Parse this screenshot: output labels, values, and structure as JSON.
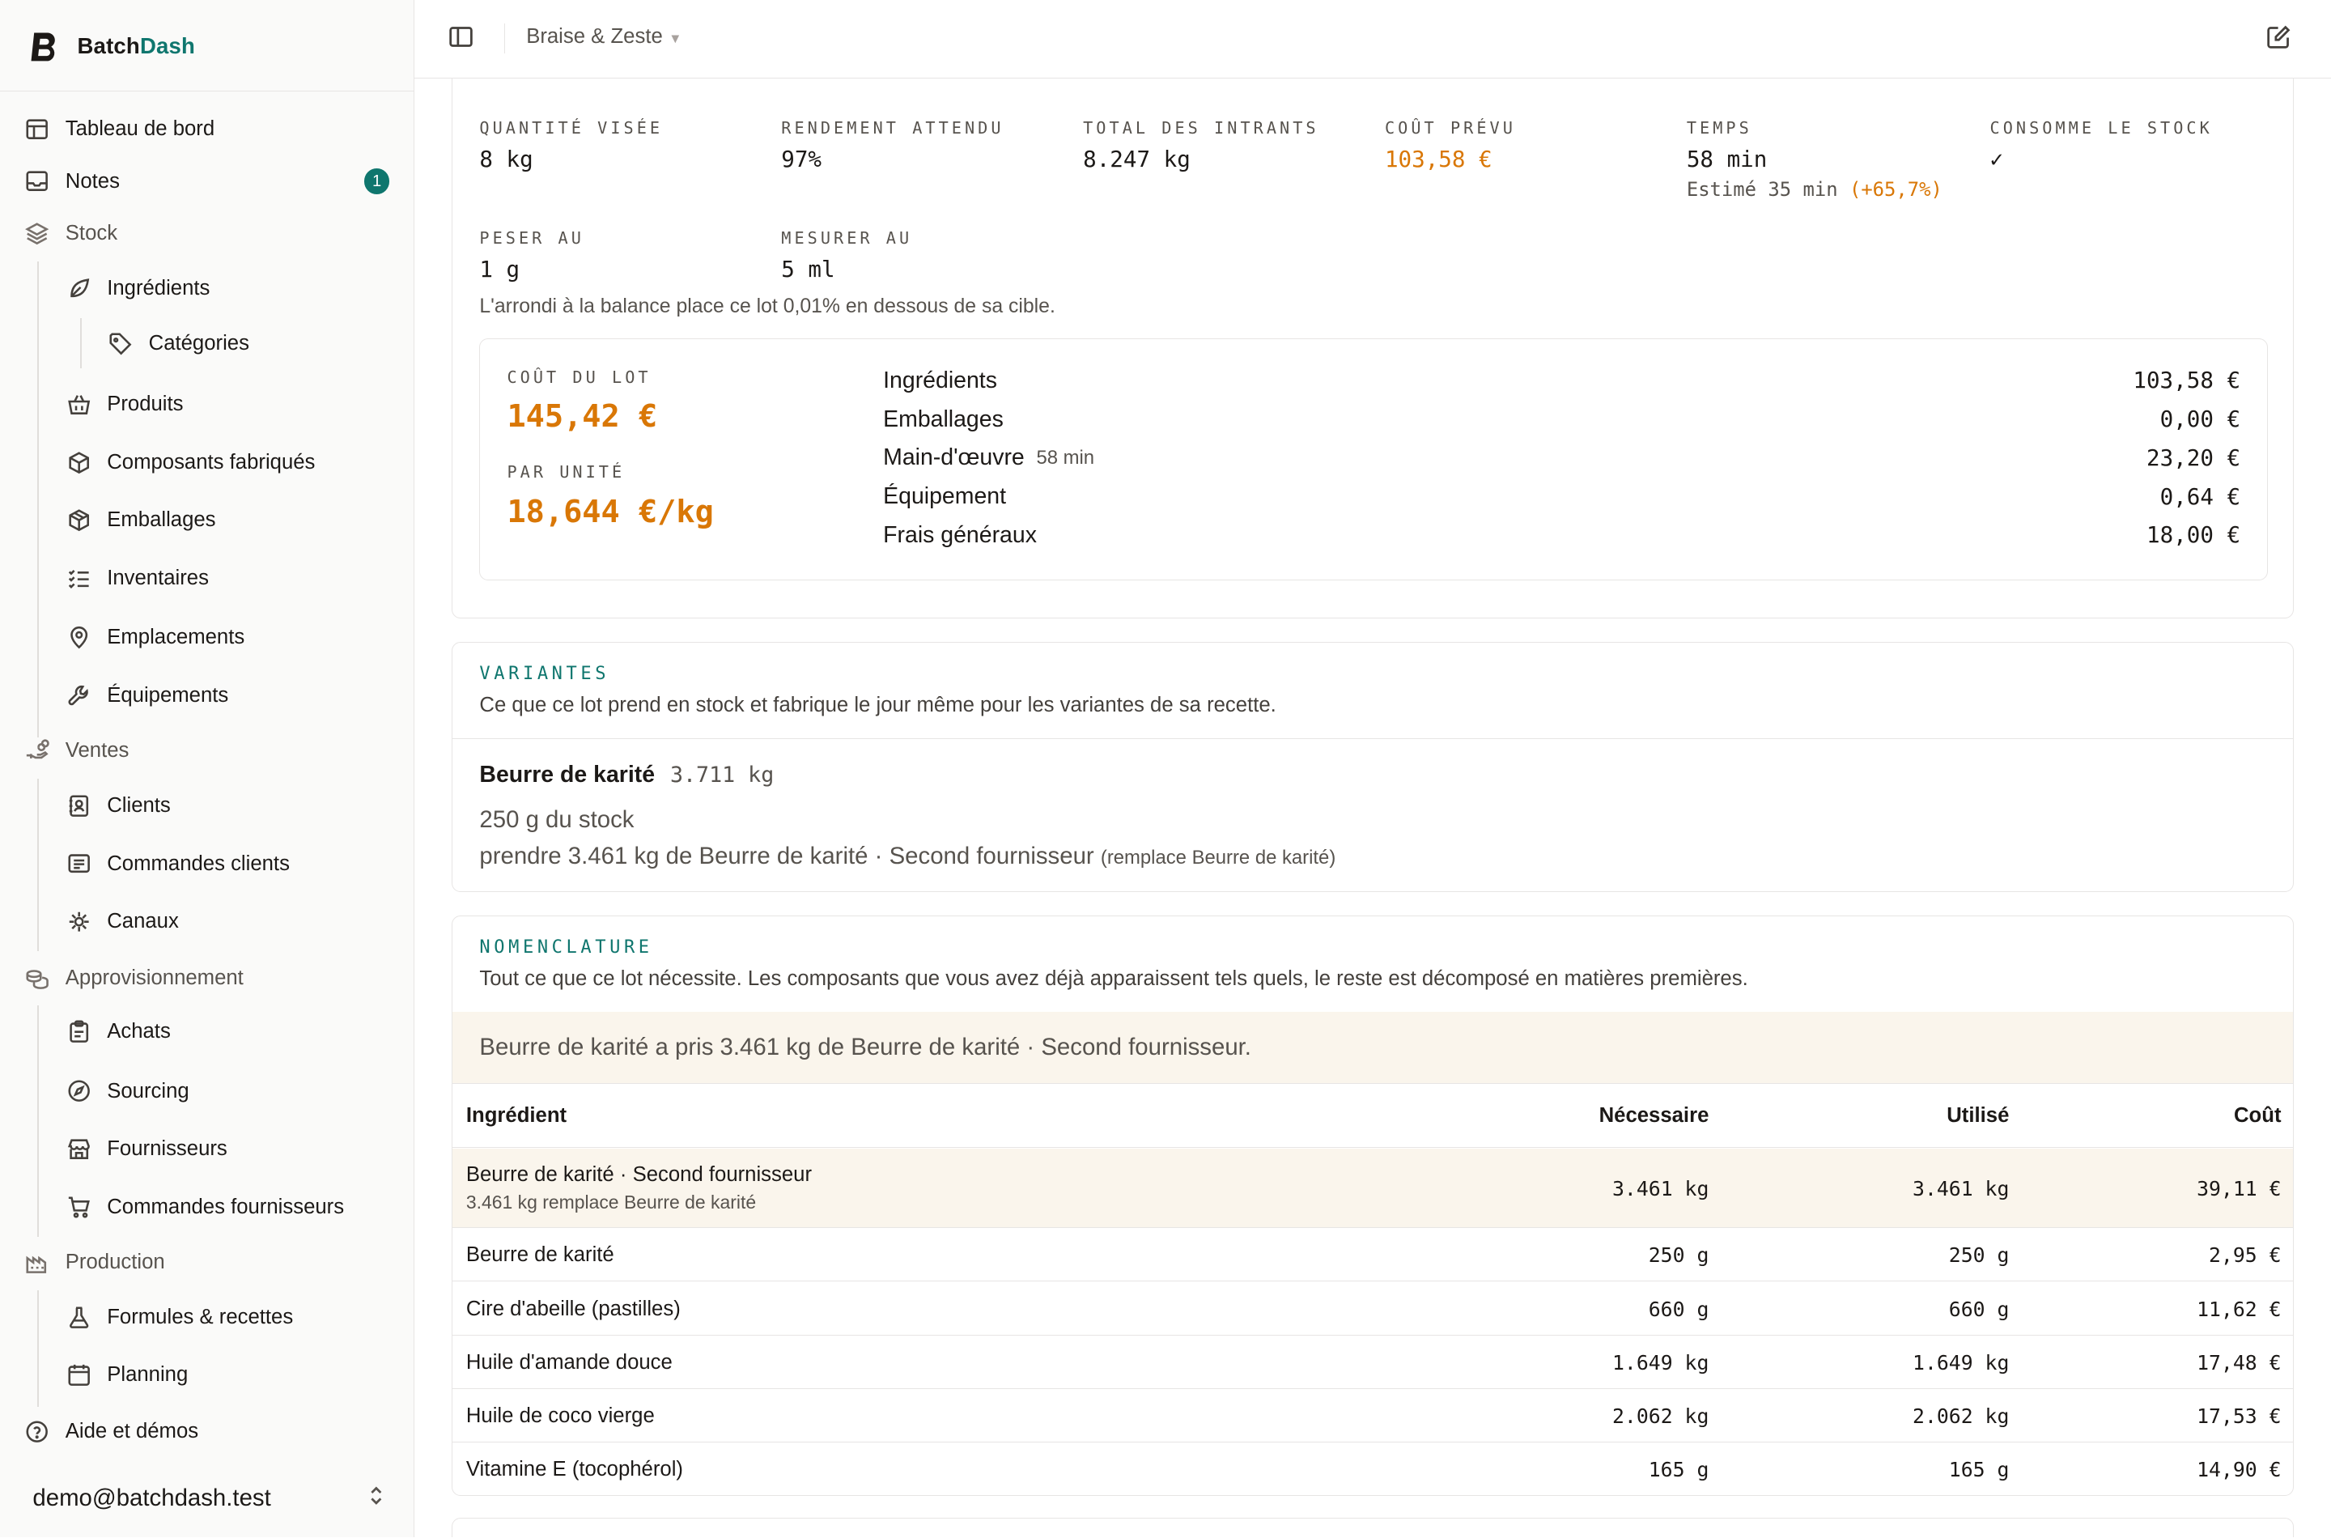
{
  "app": {
    "brand_prefix": "Batch",
    "brand_suffix": "Dash",
    "brand_color": "#0f766e",
    "accent_orange": "#d97706"
  },
  "sidebar": {
    "items": [
      {
        "label": "Tableau de bord",
        "icon": "dashboard-icon"
      },
      {
        "label": "Notes",
        "icon": "inbox-icon",
        "badge": "1"
      },
      {
        "label": "Stock",
        "icon": "layers-icon",
        "group": true
      },
      {
        "label": "Ingrédients",
        "icon": "leaf-icon"
      },
      {
        "label": "Catégories",
        "icon": "tag-icon"
      },
      {
        "label": "Produits",
        "icon": "basket-icon"
      },
      {
        "label": "Composants fabriqués",
        "icon": "cube-icon"
      },
      {
        "label": "Emballages",
        "icon": "package-icon"
      },
      {
        "label": "Inventaires",
        "icon": "checklist-icon"
      },
      {
        "label": "Emplacements",
        "icon": "map-pin-icon"
      },
      {
        "label": "Équipements",
        "icon": "wrench-icon"
      },
      {
        "label": "Ventes",
        "icon": "hand-coins-icon",
        "group": true
      },
      {
        "label": "Clients",
        "icon": "contact-icon"
      },
      {
        "label": "Commandes clients",
        "icon": "receipt-icon"
      },
      {
        "label": "Canaux",
        "icon": "network-icon"
      },
      {
        "label": "Approvisionnement",
        "icon": "coins-icon",
        "group": true
      },
      {
        "label": "Achats",
        "icon": "clipboard-icon"
      },
      {
        "label": "Sourcing",
        "icon": "compass-icon"
      },
      {
        "label": "Fournisseurs",
        "icon": "store-icon"
      },
      {
        "label": "Commandes fournisseurs",
        "icon": "cart-icon"
      },
      {
        "label": "Production",
        "icon": "factory-icon",
        "group": true
      },
      {
        "label": "Formules & recettes",
        "icon": "flask-icon"
      },
      {
        "label": "Planning",
        "icon": "calendar-icon"
      },
      {
        "label": "Aide et démos",
        "icon": "help-icon"
      }
    ],
    "user_email": "demo@batchdash.test"
  },
  "topbar": {
    "workspace": "Braise & Zeste"
  },
  "summary": {
    "stats": [
      {
        "label": "QUANTITÉ VISÉE",
        "value": "8 kg"
      },
      {
        "label": "RENDEMENT ATTENDU",
        "value": "97%"
      },
      {
        "label": "TOTAL DES INTRANTS",
        "value": "8.247 kg"
      },
      {
        "label": "COÛT PRÉVU",
        "value": "103,58 €"
      },
      {
        "label": "TEMPS",
        "value": "58 min",
        "note_prefix": "Estimé 35 min",
        "note_delta": "(+65,7%)"
      },
      {
        "label": "CONSOMME LE STOCK",
        "value": "✓"
      },
      {
        "label": "PESER AU",
        "value": "1 g"
      },
      {
        "label": "MESURER AU",
        "value": "5 ml"
      }
    ],
    "rounding_note": "L'arrondi à la balance place ce lot 0,01% en dessous de sa cible.",
    "cost_box": {
      "batch_label": "COÛT DU LOT",
      "batch_value": "145,42 €",
      "unit_label": "PAR UNITÉ",
      "unit_value": "18,644 €/kg",
      "rows": [
        {
          "label": "Ingrédients",
          "amount": "103,58 €"
        },
        {
          "label": "Emballages",
          "amount": "0,00 €"
        },
        {
          "label": "Main-d'œuvre",
          "note": "58 min",
          "amount": "23,20 €"
        },
        {
          "label": "Équipement",
          "amount": "0,64 €"
        },
        {
          "label": "Frais généraux",
          "amount": "18,00 €"
        }
      ]
    }
  },
  "variantes": {
    "title": "VARIANTES",
    "subtitle": "Ce que ce lot prend en stock et fabrique le jour même pour les variantes de sa recette.",
    "item_name": "Beurre de karité",
    "item_qty": "3.711 kg",
    "line1": "250 g du stock",
    "line2": "prendre 3.461 kg de Beurre de karité · Second fournisseur",
    "line2_note": "(remplace Beurre de karité)"
  },
  "nomenclature": {
    "title": "NOMENCLATURE",
    "subtitle": "Tout ce que ce lot nécessite. Les composants que vous avez déjà apparaissent tels quels, le reste est décomposé en matières premières.",
    "notice": "Beurre de karité a pris 3.461 kg de Beurre de karité · Second fournisseur.",
    "columns": [
      "Ingrédient",
      "Nécessaire",
      "Utilisé",
      "Coût"
    ],
    "rows": [
      {
        "name": "Beurre de karité · Second fournisseur",
        "note": "3.461 kg remplace Beurre de karité",
        "needed": "3.461 kg",
        "used": "3.461 kg",
        "cost": "39,11 €"
      },
      {
        "name": "Beurre de karité",
        "needed": "250 g",
        "used": "250 g",
        "cost": "2,95 €"
      },
      {
        "name": "Cire d'abeille (pastilles)",
        "needed": "660 g",
        "used": "660 g",
        "cost": "11,62 €"
      },
      {
        "name": "Huile d'amande douce",
        "needed": "1.649 kg",
        "used": "1.649 kg",
        "cost": "17,48 €"
      },
      {
        "name": "Huile de coco vierge",
        "needed": "2.062 kg",
        "used": "2.062 kg",
        "cost": "17,53 €"
      },
      {
        "name": "Vitamine E (tocophérol)",
        "needed": "165 g",
        "used": "165 g",
        "cost": "14,90 €"
      }
    ]
  }
}
